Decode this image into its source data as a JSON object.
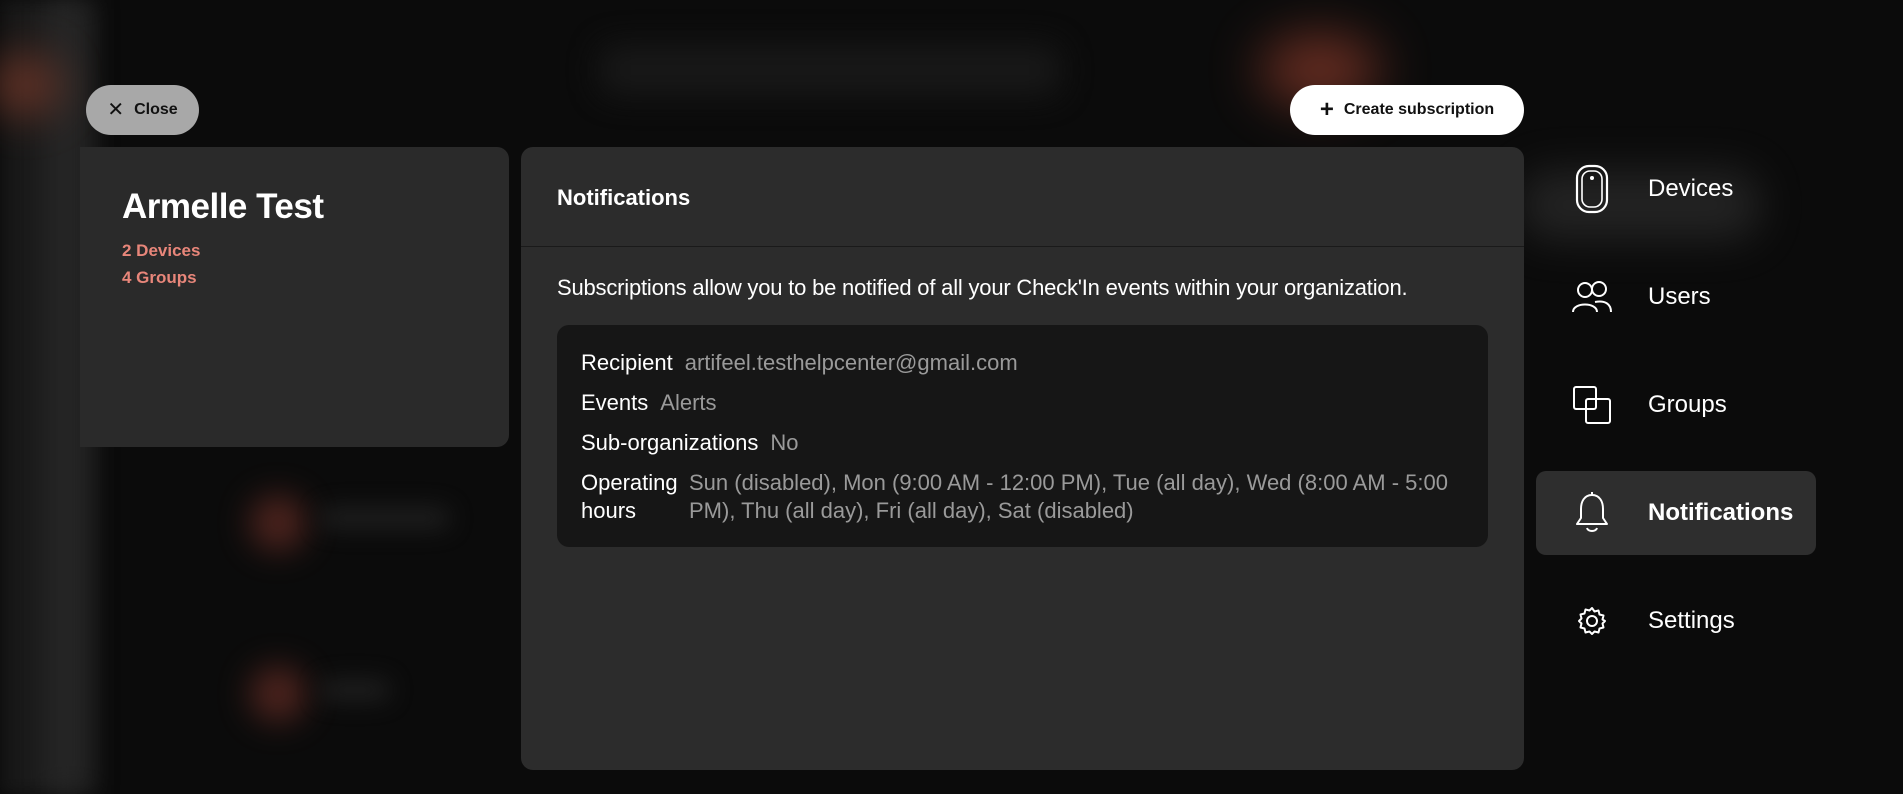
{
  "close_button": {
    "label": "Close",
    "icon": "close-icon"
  },
  "create_button": {
    "label": "Create subscription",
    "icon": "plus-icon"
  },
  "profile": {
    "name": "Armelle Test",
    "devices": "2 Devices",
    "groups": "4 Groups",
    "accent_color": "#e8867a"
  },
  "panel": {
    "title": "Notifications",
    "intro": "Subscriptions allow you to be notified of all your Check'In events within your organization.",
    "subscription": {
      "recipient_label": "Recipient",
      "recipient_value": "artifeel.testhelpcenter@gmail.com",
      "events_label": "Events",
      "events_value": "Alerts",
      "suborg_label": "Sub-organizations",
      "suborg_value": "No",
      "hours_label": "Operating hours",
      "hours_value": "Sun (disabled), Mon (9:00 AM - 12:00 PM), Tue (all day), Wed (8:00 AM - 5:00 PM), Thu (all day), Fri (all day), Sat (disabled)"
    }
  },
  "nav": {
    "items": [
      {
        "label": "Devices",
        "icon": "device-icon",
        "active": false
      },
      {
        "label": "Users",
        "icon": "users-icon",
        "active": false
      },
      {
        "label": "Groups",
        "icon": "groups-icon",
        "active": false
      },
      {
        "label": "Notifications",
        "icon": "bell-icon",
        "active": true
      },
      {
        "label": "Settings",
        "icon": "gear-icon",
        "active": false
      }
    ]
  }
}
